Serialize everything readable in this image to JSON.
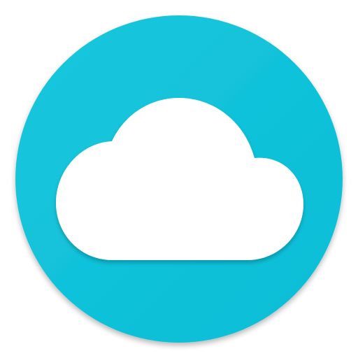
{
  "app_icon": {
    "icon_name": "cloud-icon",
    "colors": {
      "badge": "#05BDD6",
      "badge_highlight": "#1CC7DD",
      "badge_shadow": "#0AA6BC",
      "cloud": "#FFFFFF",
      "background": "#FFFFFF"
    }
  }
}
